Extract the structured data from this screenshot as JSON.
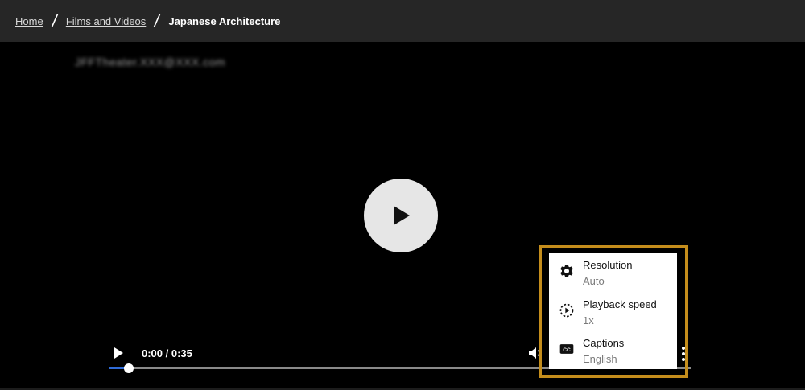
{
  "breadcrumb": {
    "items": [
      {
        "label": "Home"
      },
      {
        "label": "Films and Videos"
      }
    ],
    "current": "Japanese Architecture"
  },
  "player": {
    "watermark": "JFFTheater.XXX@XXX.com",
    "time": "0:00 / 0:35",
    "progress": 0.03
  },
  "settings_menu": {
    "items": [
      {
        "label": "Resolution",
        "value": "Auto",
        "icon": "gear-icon"
      },
      {
        "label": "Playback speed",
        "value": "1x",
        "icon": "playback-speed-icon"
      },
      {
        "label": "Captions",
        "value": "English",
        "icon": "captions-icon"
      }
    ]
  },
  "colors": {
    "highlight": "#c48d1c",
    "progress": "#2f6bd8",
    "topbar": "#262626"
  }
}
